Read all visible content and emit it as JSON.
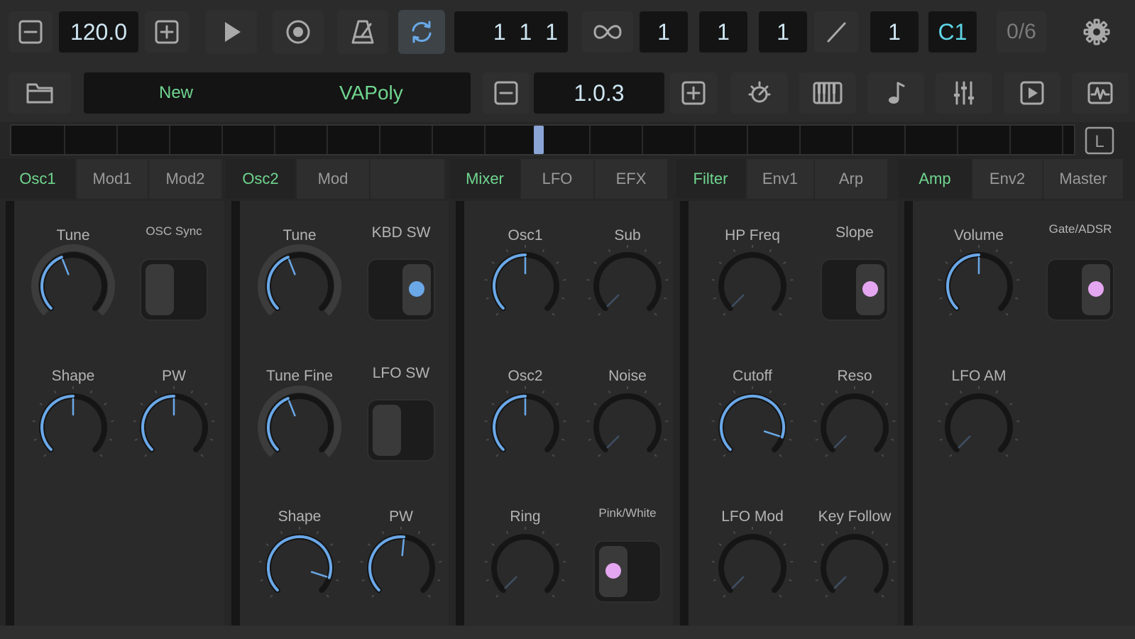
{
  "transport": {
    "tempo": "120.0",
    "position": "1 1 1",
    "quantize_values": [
      "1",
      "1",
      "1"
    ],
    "step": "1",
    "note": "C1",
    "counter": "0/6"
  },
  "preset": {
    "new_label": "New",
    "name": "VAPoly",
    "version": "1.0.3"
  },
  "loop_marker": "L",
  "tabs": [
    {
      "label": "Osc1",
      "active": true
    },
    {
      "label": "Mod1",
      "active": false
    },
    {
      "label": "Mod2",
      "active": false
    },
    {
      "label": "Osc2",
      "active": true
    },
    {
      "label": "Mod",
      "active": false
    },
    {
      "label": "",
      "active": false
    },
    {
      "label": "Mixer",
      "active": true
    },
    {
      "label": "LFO",
      "active": false
    },
    {
      "label": "EFX",
      "active": false
    },
    {
      "label": "Filter",
      "active": true
    },
    {
      "label": "Env1",
      "active": false
    },
    {
      "label": "Arp",
      "active": false
    },
    {
      "label": "Amp",
      "active": true
    },
    {
      "label": "Env2",
      "active": false
    },
    {
      "label": "Master",
      "active": false
    }
  ],
  "controls": {
    "osc1": {
      "tune": {
        "label": "Tune",
        "value": 0.42
      },
      "osc_sync": {
        "label": "OSC Sync",
        "on": false
      },
      "shape": {
        "label": "Shape",
        "value": 0.5
      },
      "pw": {
        "label": "PW",
        "value": 0.5
      }
    },
    "osc2": {
      "tune": {
        "label": "Tune",
        "value": 0.42
      },
      "kbd_sw": {
        "label": "KBD SW",
        "on": true
      },
      "tune_fine": {
        "label": "Tune Fine",
        "value": 0.42
      },
      "lfo_sw": {
        "label": "LFO SW",
        "on": false
      },
      "shape": {
        "label": "Shape",
        "value": 0.9
      },
      "pw": {
        "label": "PW",
        "value": 0.52
      }
    },
    "mixer": {
      "osc1": {
        "label": "Osc1",
        "value": 0.5
      },
      "sub": {
        "label": "Sub",
        "value": 0.0
      },
      "osc2": {
        "label": "Osc2",
        "value": 0.5
      },
      "noise": {
        "label": "Noise",
        "value": 0.0
      },
      "ring": {
        "label": "Ring",
        "value": 0.0
      },
      "pink_white": {
        "label": "Pink/White",
        "on": false
      }
    },
    "filter": {
      "hp_freq": {
        "label": "HP Freq",
        "value": 0.0
      },
      "slope": {
        "label": "Slope",
        "on": true
      },
      "cutoff": {
        "label": "Cutoff",
        "value": 0.9
      },
      "reso": {
        "label": "Reso",
        "value": 0.0
      },
      "lfo_mod": {
        "label": "LFO Mod",
        "value": 0.0
      },
      "key_follow": {
        "label": "Key Follow",
        "value": 0.0
      }
    },
    "amp": {
      "volume": {
        "label": "Volume",
        "value": 0.5
      },
      "gate_adsr": {
        "label": "Gate/ADSR",
        "on": true
      },
      "lfo_am": {
        "label": "LFO AM",
        "value": 0.0
      }
    }
  },
  "colors": {
    "accent_blue": "#6aa8e8",
    "accent_green": "#6fd68f",
    "accent_pink": "#e4a6f0",
    "display_text": "#cfe7f3"
  }
}
